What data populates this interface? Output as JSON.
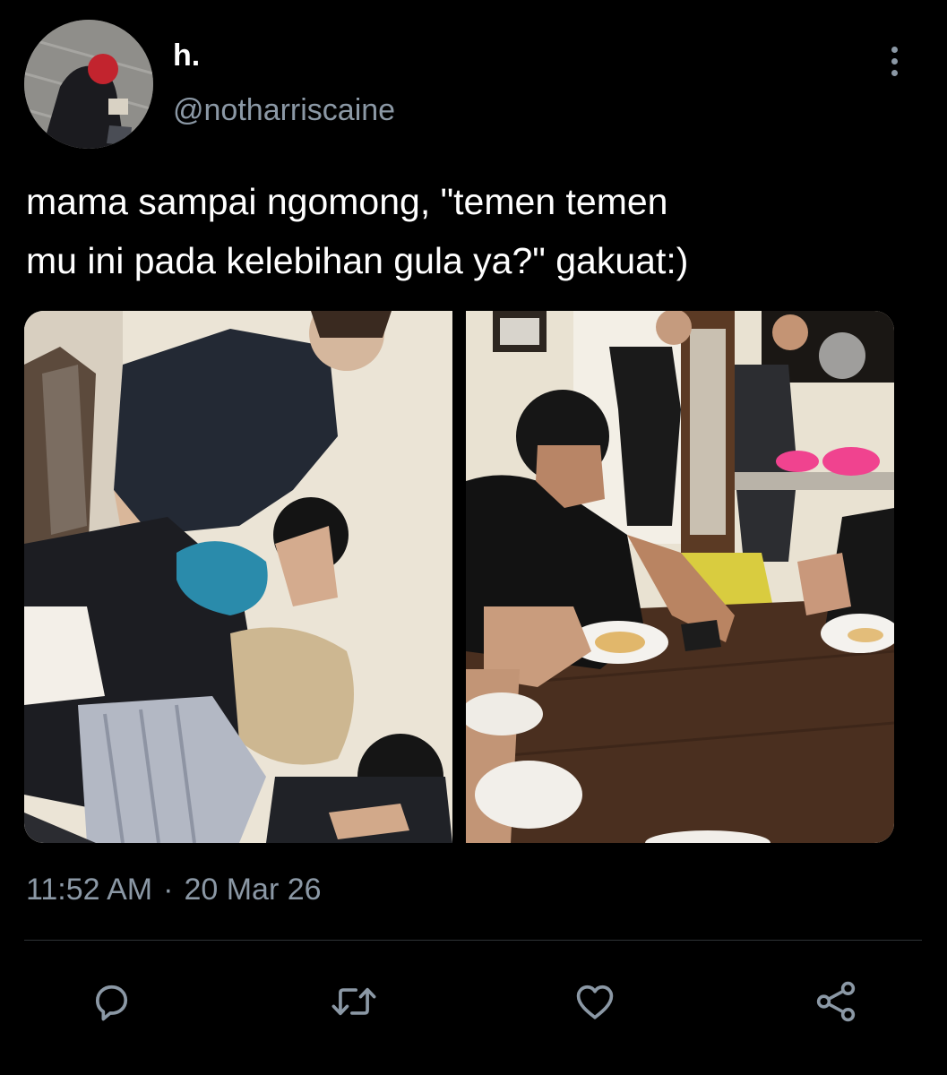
{
  "tweet": {
    "author": {
      "display_name": "h.",
      "handle": "@notharriscaine",
      "avatar_icon": "profile-photo"
    },
    "text": "mama sampai ngomong, \"temen temen\nmu ini pada kelebihan gula ya?\" gakuat:)",
    "media": [
      {
        "description_icon": "photo-group-pile"
      },
      {
        "description_icon": "photo-dinner-table"
      }
    ],
    "time": "11:52 AM",
    "separator": "·",
    "date": "20 Mar 26",
    "actions": {
      "reply_icon": "reply-icon",
      "retweet_icon": "retweet-icon",
      "like_icon": "heart-icon",
      "share_icon": "share-icon"
    }
  },
  "colors": {
    "background": "#000000",
    "text_primary": "#ffffff",
    "text_secondary": "#8b98a5",
    "divider": "#2f3336",
    "accent": "#1d9bf0"
  }
}
